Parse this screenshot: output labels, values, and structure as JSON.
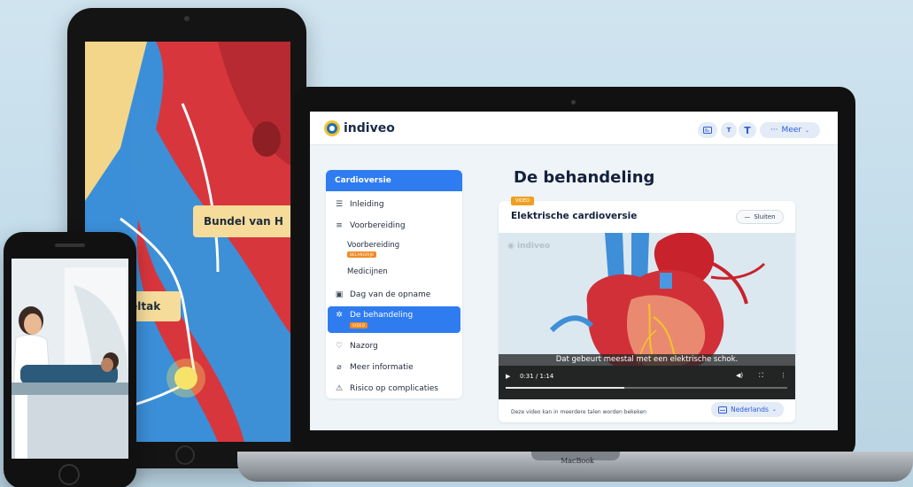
{
  "tablet": {
    "callout_1": "Bundel van H",
    "callout_2": "ndeltak"
  },
  "laptop": {
    "brand_label": "MacBook"
  },
  "header": {
    "logo_text": "indiveo",
    "text_size_small": "T",
    "text_size_large": "T",
    "more_label": "Meer",
    "more_icon": "ellipsis-icon"
  },
  "sidebar": {
    "section_title": "Cardioversie",
    "items": [
      {
        "label": "Inleiding",
        "icon": "document-list-icon"
      },
      {
        "label": "Voorbereiding",
        "icon": "list-icon"
      },
      {
        "label": "Voorbereiding",
        "badge": "BELANGRIJK"
      },
      {
        "label": "Medicijnen"
      },
      {
        "label": "Dag van de opname",
        "icon": "calendar-icon"
      },
      {
        "label": "De behandeling",
        "badge": "VIDEO",
        "icon": "medical-icon"
      },
      {
        "label": "Nazorg",
        "icon": "heart-icon"
      },
      {
        "label": "Meer informatie",
        "icon": "paperclip-icon"
      },
      {
        "label": "Risico op complicaties",
        "icon": "warning-icon"
      }
    ]
  },
  "main": {
    "page_title": "De behandeling",
    "video": {
      "tag": "VIDEO",
      "title": "Elektrische cardioversie",
      "close_label": "Sluiten",
      "watermark": "indiveo",
      "subtitle": "Dat gebeurt meestal met een elektrische schok.",
      "time": "0:31 / 1:14",
      "progress": 0.42,
      "footer_text": "Deze video kan in meerdere talen worden bekeken",
      "language_label": "Nederlands"
    }
  },
  "colors": {
    "accent": "#2f7cf0",
    "badge_orange": "#f08a22",
    "title_dark": "#14213d"
  }
}
